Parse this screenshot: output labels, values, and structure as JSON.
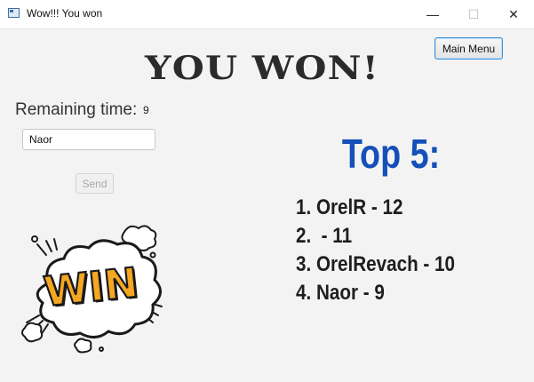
{
  "window": {
    "title": "Wow!!! You won",
    "icons": {
      "app": "window-app-icon",
      "minimize": "minimize-icon",
      "maximize": "maximize-icon",
      "close": "close-icon"
    }
  },
  "header": {
    "main_menu_label": "Main Menu",
    "heading": "YOU WON!"
  },
  "timer": {
    "label": "Remaining time:",
    "value": "9"
  },
  "form": {
    "name_value": "Naor",
    "send_label": "Send"
  },
  "leaderboard": {
    "title": "Top 5:",
    "title_color": "#1450b8",
    "entries": [
      "1. OrelR - 12",
      "2.  - 11",
      "3. OrelRevach - 10",
      "4. Naor - 9"
    ]
  },
  "sticker": {
    "text": "WIN",
    "colors": {
      "fill": "#f5a623",
      "outline": "#1a1a1a",
      "bubble": "#ffffff"
    }
  }
}
